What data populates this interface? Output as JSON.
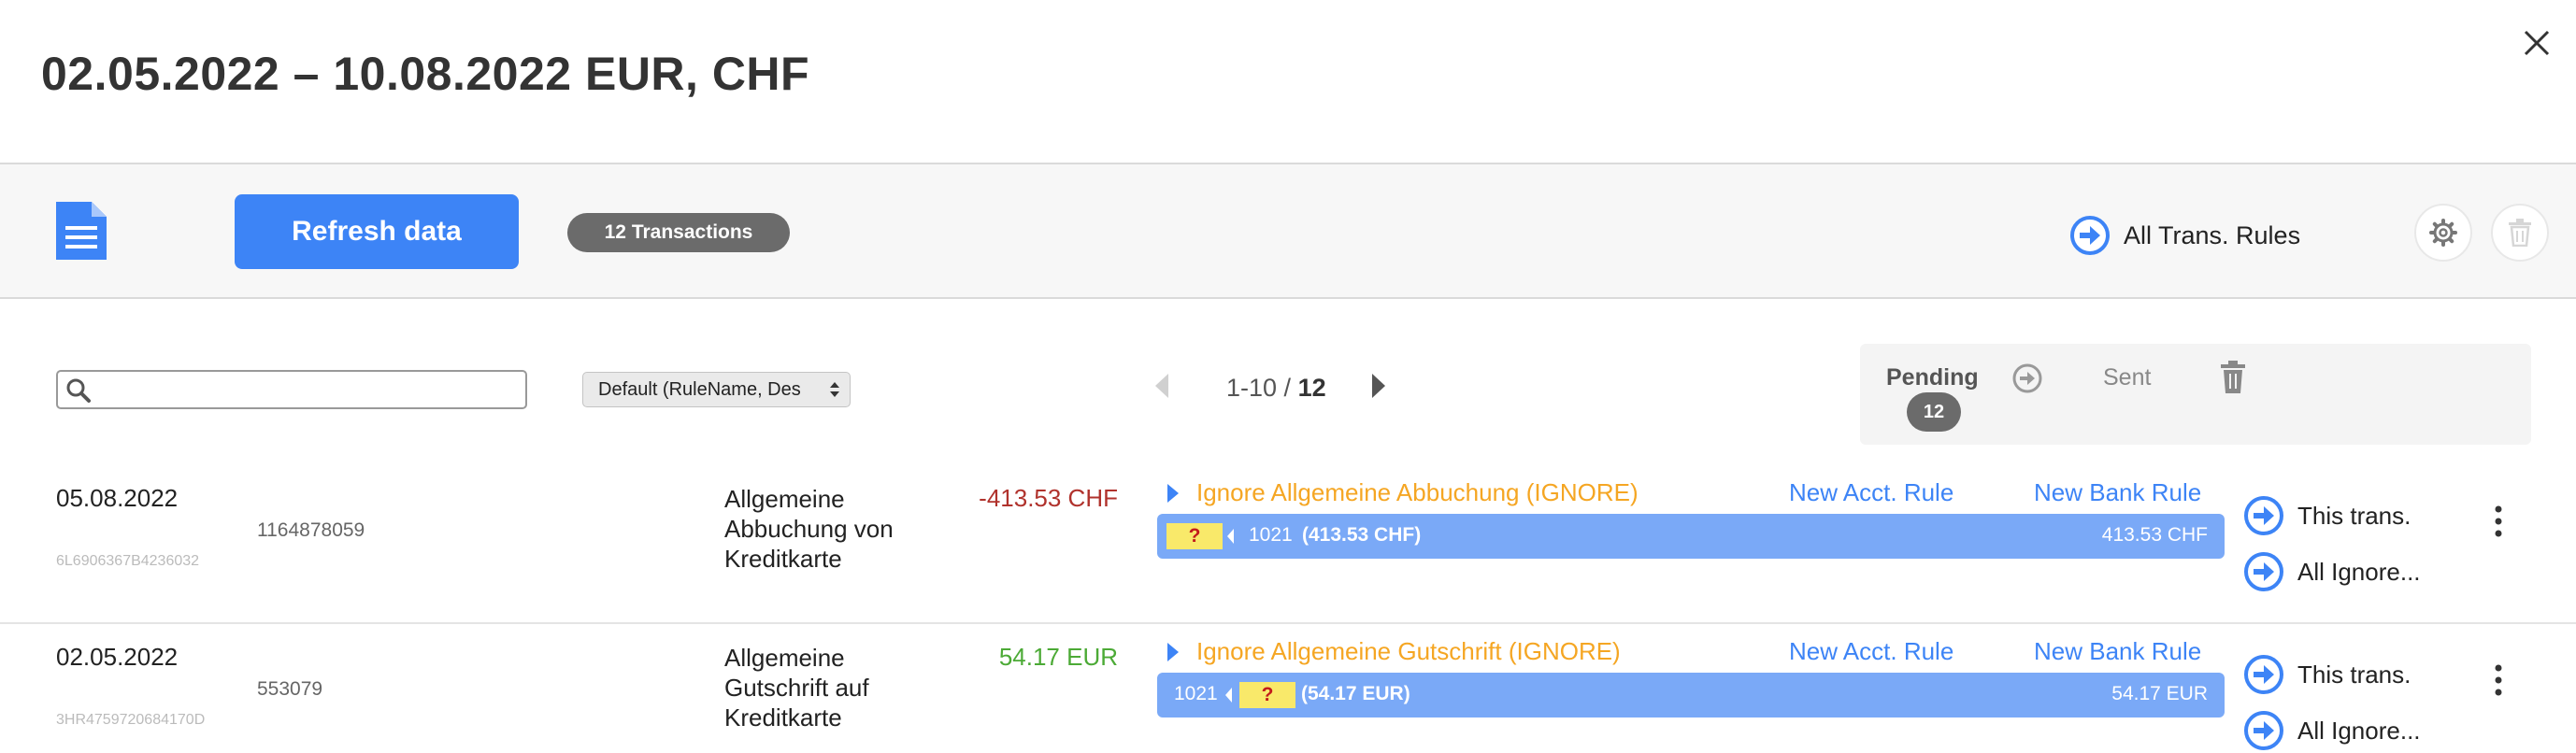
{
  "header": {
    "title": "02.05.2022 – 10.08.2022 EUR, CHF"
  },
  "toolbar": {
    "refresh_label": "Refresh data",
    "transactions_badge": "12 Transactions",
    "all_rules_label": "All Trans. Rules"
  },
  "filters": {
    "search_value": "",
    "sort_selected": "Default (RuleName, Des"
  },
  "pager": {
    "range": "1-10 /",
    "total": "12"
  },
  "status": {
    "pending_label": "Pending",
    "pending_count": "12",
    "sent_label": "Sent"
  },
  "rows": [
    {
      "date": "05.08.2022",
      "number": "1164878059",
      "ref": "6L6906367B4236032",
      "description": "Allgemeine Abbuchung von Kreditkarte",
      "amount": "-413.53 CHF",
      "rule": "Ignore Allgemeine Abbuchung (IGNORE)",
      "new_acct_rule": "New Acct. Rule",
      "new_bank_rule": "New Bank Rule",
      "bar_question": "?",
      "bar_account": "1021",
      "bar_amount": "(413.53 CHF)",
      "bar_right": "413.53 CHF",
      "action_this": "This trans.",
      "action_all": "All Ignore..."
    },
    {
      "date": "02.05.2022",
      "number": "553079",
      "ref": "3HR4759720684170D",
      "description": "Allgemeine Gutschrift auf Kreditkarte",
      "amount": "54.17 EUR",
      "rule": "Ignore Allgemeine Gutschrift (IGNORE)",
      "new_acct_rule": "New Acct. Rule",
      "new_bank_rule": "New Bank Rule",
      "bar_question": "?",
      "bar_account": "1021",
      "bar_amount": "(54.17 EUR)",
      "bar_right": "54.17 EUR",
      "action_this": "This trans.",
      "action_all": "All Ignore..."
    }
  ],
  "colors": {
    "accent_blue": "#3d84f6",
    "bar_blue": "#7aa9f7",
    "rule_orange": "#f5a623",
    "negative_red": "#b0322c",
    "positive_green": "#4caa36",
    "question_yellow": "#f9e96a"
  }
}
